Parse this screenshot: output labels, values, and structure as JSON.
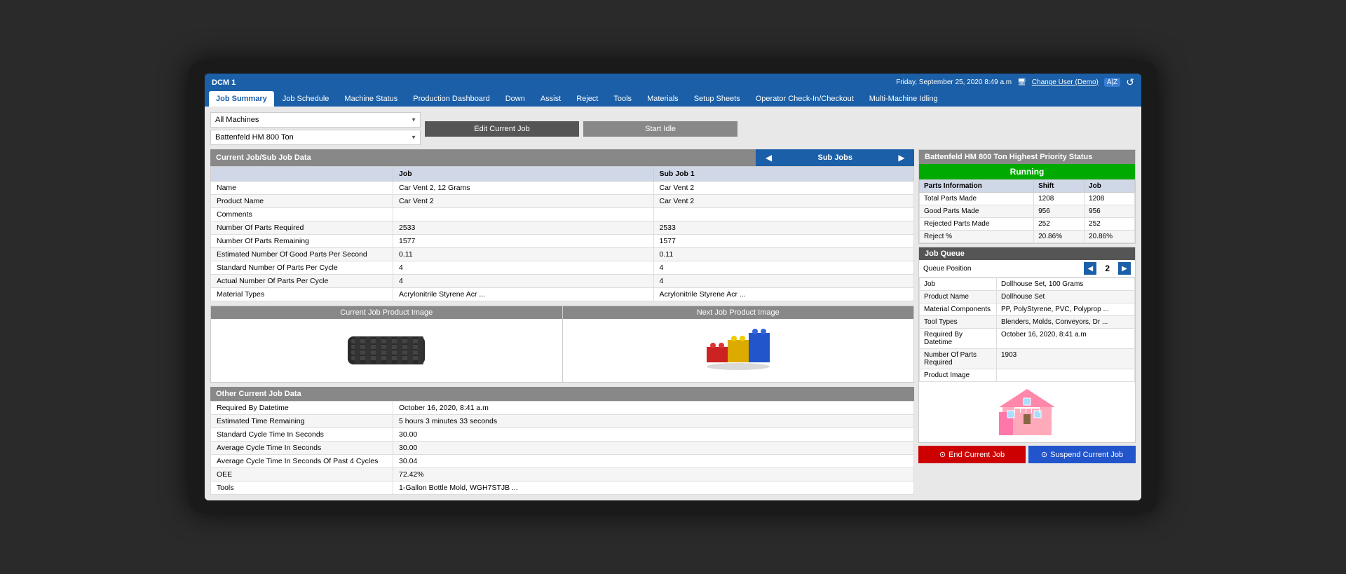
{
  "topbar": {
    "title": "DCM 1",
    "datetime": "Friday, September 25, 2020  8:49 a.m",
    "change_user": "Change User (Demo)",
    "lang": "A|Z",
    "refresh_icon": "↺"
  },
  "nav": {
    "items": [
      {
        "label": "Job Summary",
        "active": true
      },
      {
        "label": "Job Schedule",
        "active": false
      },
      {
        "label": "Machine Status",
        "active": false
      },
      {
        "label": "Production Dashboard",
        "active": false
      },
      {
        "label": "Down",
        "active": false
      },
      {
        "label": "Assist",
        "active": false
      },
      {
        "label": "Reject",
        "active": false
      },
      {
        "label": "Tools",
        "active": false
      },
      {
        "label": "Materials",
        "active": false
      },
      {
        "label": "Setup Sheets",
        "active": false
      },
      {
        "label": "Operator Check-In/Checkout",
        "active": false
      },
      {
        "label": "Multi-Machine Idling",
        "active": false
      }
    ]
  },
  "toolbar": {
    "machine_options": [
      "All Machines"
    ],
    "machine_selected": "All Machines",
    "machine2_selected": "Battenfeld HM 800 Ton",
    "edit_job_label": "Edit Current Job",
    "start_idle_label": "Start Idle"
  },
  "current_job_section": {
    "header": "Current Job/Sub Job Data",
    "sub_jobs_label": "Sub Jobs",
    "columns": {
      "job": "Job",
      "sub_job_1": "Sub Job 1"
    },
    "rows": [
      {
        "label": "Name",
        "job": "Car Vent 2, 12 Grams",
        "sub_job": "Car Vent 2"
      },
      {
        "label": "Product Name",
        "job": "Car Vent 2",
        "sub_job": "Car Vent 2"
      },
      {
        "label": "Comments",
        "job": "",
        "sub_job": ""
      },
      {
        "label": "Number Of Parts Required",
        "job": "2533",
        "sub_job": "2533"
      },
      {
        "label": "Number Of Parts Remaining",
        "job": "1577",
        "sub_job": "1577"
      },
      {
        "label": "Estimated Number Of Good Parts Per Second",
        "job": "0.11",
        "sub_job": "0.11"
      },
      {
        "label": "Standard Number Of Parts Per Cycle",
        "job": "4",
        "sub_job": "4"
      },
      {
        "label": "Actual Number Of Parts Per Cycle",
        "job": "4",
        "sub_job": "4"
      },
      {
        "label": "Material Types",
        "job": "Acrylonitrile Styrene Acr ...",
        "sub_job": "Acrylonitrile Styrene Acr ..."
      }
    ]
  },
  "product_images": {
    "current_header": "Current Job Product Image",
    "next_header": "Next Job Product Image"
  },
  "other_job_data": {
    "header": "Other Current Job Data",
    "rows": [
      {
        "label": "Required By Datetime",
        "value": "October 16, 2020, 8:41 a.m"
      },
      {
        "label": "Estimated Time Remaining",
        "value": "5 hours 3 minutes 33 seconds"
      },
      {
        "label": "Standard Cycle Time In Seconds",
        "value": "30.00"
      },
      {
        "label": "Average Cycle Time In Seconds",
        "value": "30.00"
      },
      {
        "label": "Average Cycle Time In Seconds Of Past 4 Cycles",
        "value": "30.04"
      },
      {
        "label": "OEE",
        "value": "72.42%"
      },
      {
        "label": "Tools",
        "value": "1-Gallon Bottle Mold, WGH7STJB ..."
      }
    ]
  },
  "right_panel": {
    "machine_status_header": "Battenfeld HM 800 Ton Highest Priority Status",
    "status": "Running",
    "parts_info": {
      "header": "Parts Information",
      "columns": [
        "",
        "Shift",
        "Job"
      ],
      "rows": [
        {
          "label": "Total Parts Made",
          "shift": "1208",
          "job": "1208"
        },
        {
          "label": "Good Parts Made",
          "shift": "956",
          "job": "956"
        },
        {
          "label": "Rejected Parts Made",
          "shift": "252",
          "job": "252"
        },
        {
          "label": "Reject %",
          "shift": "20.86%",
          "job": "20.86%"
        }
      ]
    },
    "job_queue": {
      "header": "Job Queue",
      "queue_position_label": "Queue Position",
      "queue_number": "2",
      "rows": [
        {
          "label": "Job",
          "value": "Dollhouse Set, 100 Grams"
        },
        {
          "label": "Product Name",
          "value": "Dollhouse Set"
        },
        {
          "label": "Material Components",
          "value": "PP, PolyStyrene, PVC, Polyprop ..."
        },
        {
          "label": "Tool Types",
          "value": "Blenders, Molds, Conveyors, Dr ..."
        },
        {
          "label": "Required By Datetime",
          "value": "October 16, 2020, 8:41 a.m"
        },
        {
          "label": "Number Of Parts Required",
          "value": "1903"
        },
        {
          "label": "Product Image",
          "value": ""
        }
      ]
    },
    "end_job_label": "End Current Job",
    "suspend_job_label": "Suspend Current Job"
  }
}
